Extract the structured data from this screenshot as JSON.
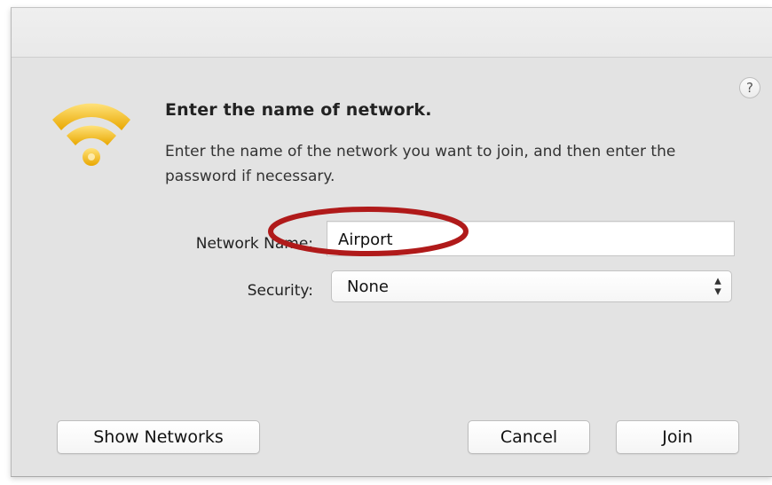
{
  "dialog": {
    "heading": "Enter the name of network.",
    "description": "Enter the name of the network you want to join, and then enter the password if necessary.",
    "help_label": "?"
  },
  "icons": {
    "wifi": "wifi-icon",
    "help": "help-icon",
    "select_chevrons": "up-down-chevron-icon"
  },
  "form": {
    "network_name_label": "Network Name:",
    "network_name_value": "Airport",
    "security_label": "Security:",
    "security_value": "None"
  },
  "buttons": {
    "show_networks": "Show Networks",
    "cancel": "Cancel",
    "join": "Join"
  },
  "colors": {
    "wifi_gold": "#f5c12a",
    "annotation_red": "#b01a1a",
    "window_bg": "#e3e3e3"
  }
}
